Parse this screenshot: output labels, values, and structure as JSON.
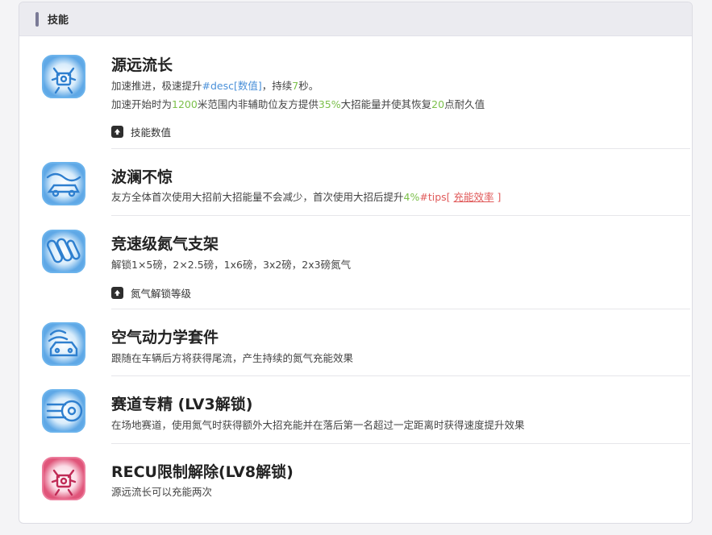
{
  "header": {
    "title": "技能"
  },
  "skills": [
    {
      "title": "源远流长",
      "line1": {
        "prefix": "加速推进，极速提升",
        "var": "#desc[数值]",
        "mid": "，持续",
        "num": "7",
        "suffix": "秒。"
      },
      "line2": {
        "p1": "加速开始时为",
        "n1": "1200",
        "p2": "米范围内非辅助位友方提供",
        "n2": "35%",
        "p3": "大招能量并使其恢复",
        "n3": "20",
        "p4": "点耐久值"
      },
      "expand_label": "技能数值"
    },
    {
      "title": "波澜不惊",
      "line1": {
        "prefix": "友方全体首次使用大招前大招能量不会减少，首次使用大招后提升",
        "num": "4%",
        "tag": "#tips[ ",
        "link": "充能效率",
        "tag_end": " ]"
      }
    },
    {
      "title": "竞速级氮气支架",
      "desc": "解锁1×5磅，2×2.5磅，1x6磅，3x2磅，2x3磅氮气",
      "expand_label": "氮气解锁等级"
    },
    {
      "title": "空气动力学套件",
      "desc": "跟随在车辆后方将获得尾流，产生持续的氮气充能效果"
    },
    {
      "title": "赛道专精 (LV3解锁)",
      "desc": "在场地赛道，使用氮气时获得额外大招充能并在落后第一名超过一定距离时获得速度提升效果"
    },
    {
      "title": "RECU限制解除(LV8解锁)",
      "desc": "源远流长可以充能两次"
    }
  ],
  "icons": [
    "engine-icon",
    "wave-car-icon",
    "nitro-tanks-icon",
    "aero-car-icon",
    "tire-icon",
    "engine-pink-icon"
  ],
  "colors": {
    "accent_blue": "#4a90d9",
    "accent_green": "#7cc04b",
    "accent_red": "#e05a5a",
    "icon_pink": "#e0557a"
  }
}
